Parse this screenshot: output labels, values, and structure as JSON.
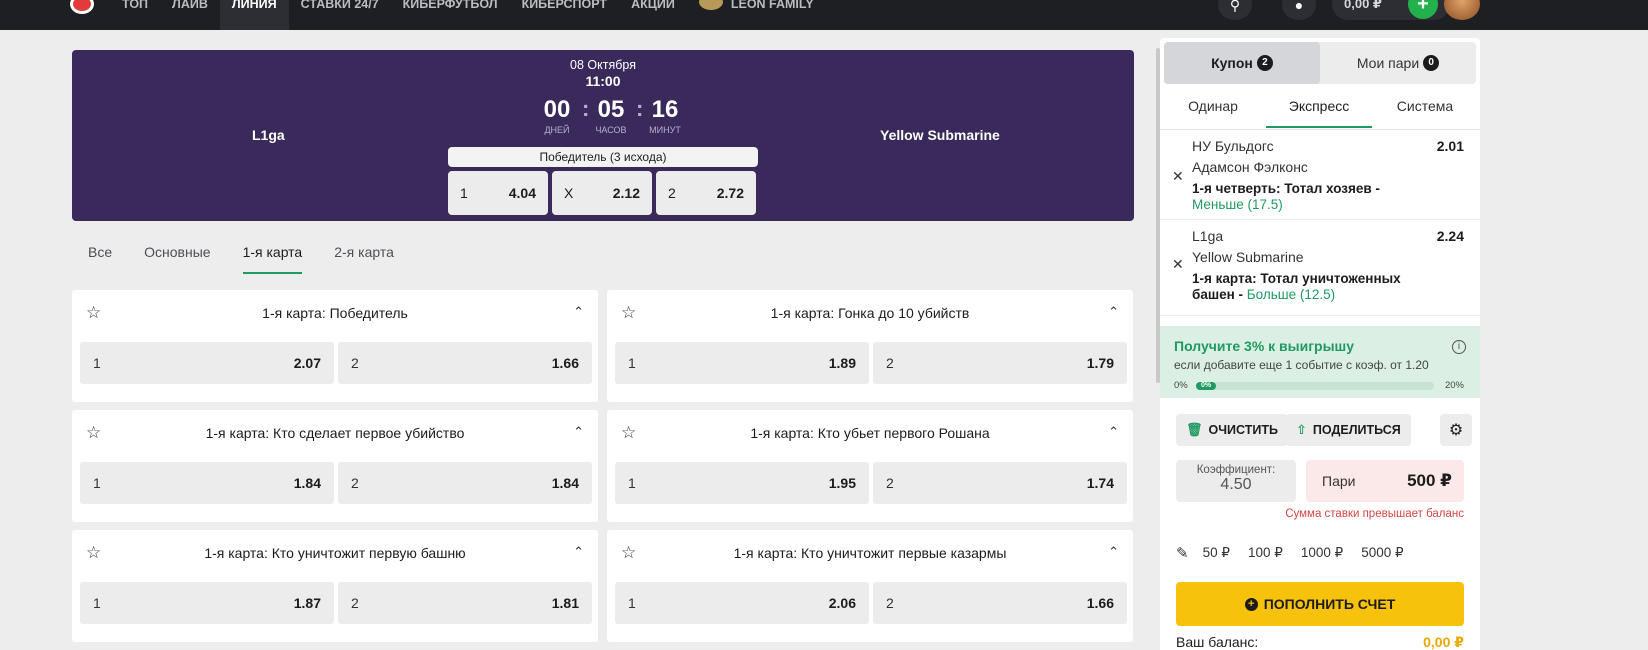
{
  "nav": {
    "items": [
      "ТОП",
      "ЛАЙВ",
      "ЛИНИЯ",
      "СТАВКИ 24/7",
      "КИБЕРФУТБОЛ",
      "КИБЕРСПОРТ",
      "АКЦИИ"
    ],
    "family_label": "LEON FAMILY",
    "active_index": 2,
    "balance": "0,00 ₽",
    "icons": [
      "search-icon",
      "bell-icon",
      "plus-icon"
    ]
  },
  "match": {
    "date": "08 Октября",
    "time": "11:00",
    "home": "L1ga",
    "away": "Yellow Submarine",
    "countdown": {
      "days": "00",
      "days_label": "ДНЕЙ",
      "hours": "05",
      "hours_label": "ЧАСОВ",
      "minutes": "16",
      "minutes_label": "МИНУТ",
      "separator": ":"
    },
    "market_name": "Победитель (3 исхода)",
    "odds": [
      {
        "label": "1",
        "value": "4.04"
      },
      {
        "label": "X",
        "value": "2.12"
      },
      {
        "label": "2",
        "value": "2.72"
      }
    ]
  },
  "tabs": [
    "Все",
    "Основные",
    "1-я карта",
    "2-я карта"
  ],
  "markets": [
    {
      "title": "1-я карта: Победитель",
      "odds": [
        {
          "label": "1",
          "value": "2.07"
        },
        {
          "label": "2",
          "value": "1.66"
        }
      ]
    },
    {
      "title": "1-я карта: Гонка до 10 убийств",
      "odds": [
        {
          "label": "1",
          "value": "1.89"
        },
        {
          "label": "2",
          "value": "1.79"
        }
      ]
    },
    {
      "title": "1-я карта: Кто сделает первое убийство",
      "odds": [
        {
          "label": "1",
          "value": "1.84"
        },
        {
          "label": "2",
          "value": "1.84"
        }
      ]
    },
    {
      "title": "1-я карта: Кто убьет первого Рошана",
      "odds": [
        {
          "label": "1",
          "value": "1.95"
        },
        {
          "label": "2",
          "value": "1.74"
        }
      ]
    },
    {
      "title": "1-я карта: Кто уничтожит первую башню",
      "odds": [
        {
          "label": "1",
          "value": "1.87"
        },
        {
          "label": "2",
          "value": "1.81"
        }
      ]
    },
    {
      "title": "1-я карта: Кто уничтожит первые казармы",
      "odds": [
        {
          "label": "1",
          "value": "2.06"
        },
        {
          "label": "2",
          "value": "1.66"
        }
      ]
    }
  ],
  "coupon": {
    "tab_coupon": "Купон",
    "coupon_count": "2",
    "tab_mybets": "Мои пари",
    "mybets_count": "0",
    "bet_types": [
      "Одинар",
      "Экспресс",
      "Система"
    ],
    "slips": [
      {
        "team1": "НУ Бульдогс",
        "team2": "Адамсон Фэлконс",
        "odd": "2.01",
        "market": "1-я четверть: Тотал хозяев - ",
        "pick": "Меньше (17.5)"
      },
      {
        "team1": "L1ga",
        "team2": "Yellow Submarine",
        "odd": "2.24",
        "market": "1-я карта: Тотал уничтоженных башен - ",
        "pick": "Больше (12.5)"
      }
    ],
    "bonus_title": "Получите 3% к выигрышу",
    "bonus_text": "если добавите еще 1 событие с коэф. от 1.20",
    "progress_min": "0%",
    "progress_value": "0%",
    "progress_max": "20%",
    "clear_label": "ОЧИСТИТЬ",
    "share_label": "ПОДЕЛИТЬСЯ",
    "coef_label": "Коэффициент:",
    "coef_value": "4.50",
    "bet_label": "Пари",
    "bet_value": "500 ₽",
    "error": "Сумма ставки превышает баланс",
    "quick_amounts": [
      "50 ₽",
      "100 ₽",
      "1000 ₽",
      "5000 ₽"
    ],
    "topup_label": "ПОПОЛНИТЬ СЧЕТ",
    "balance_label": "Ваш баланс:",
    "balance_value": "0,00 ₽"
  }
}
